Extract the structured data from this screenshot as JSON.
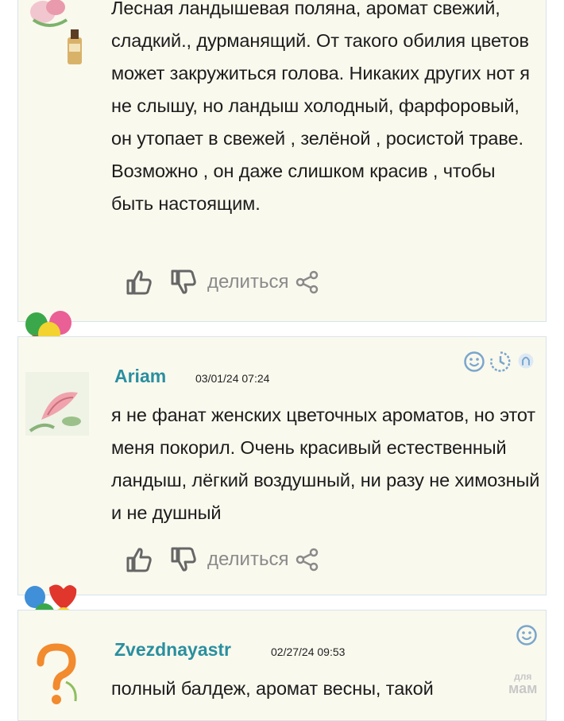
{
  "comments": [
    {
      "text": "Лесная ландышевая поляна, аромат свежий, сладкий., дурманящий. От такого обилия цветов может закружиться голова. Никаких других нот я не слышу, но ландыш холодный, фарфоровый, он утопает в свежей , зелёной , росистой траве. Возможно , он даже слишком красив , чтобы быть настоящим.",
      "share_label": "делиться"
    },
    {
      "author": "Ariam",
      "date": "03/01/24 07:24",
      "text": "я не фанат женских цветочных ароматов, но этот меня покорил. Очень красивый естественный ландыш, лёгкий воздушный, ни разу не химозный и не душный",
      "share_label": "делиться"
    },
    {
      "author": "Zvezdnayastr",
      "date": "02/27/24 09:53",
      "text": "полный балдеж, аромат весны, такой"
    }
  ],
  "watermark": {
    "line1": "для",
    "line2": "мам"
  },
  "colors": {
    "card_bg": "#faf9ee",
    "card_border": "#d7e4ec",
    "author": "#2a8f9f",
    "action": "#8a8a8a",
    "badge": "#7aa6cc"
  },
  "icons": {
    "like": "thumbs-up-icon",
    "dislike": "thumbs-down-icon",
    "share": "share-icon",
    "smile": "smile-badge-icon",
    "clock": "clock-badge-icon",
    "user": "user-badge-icon"
  }
}
